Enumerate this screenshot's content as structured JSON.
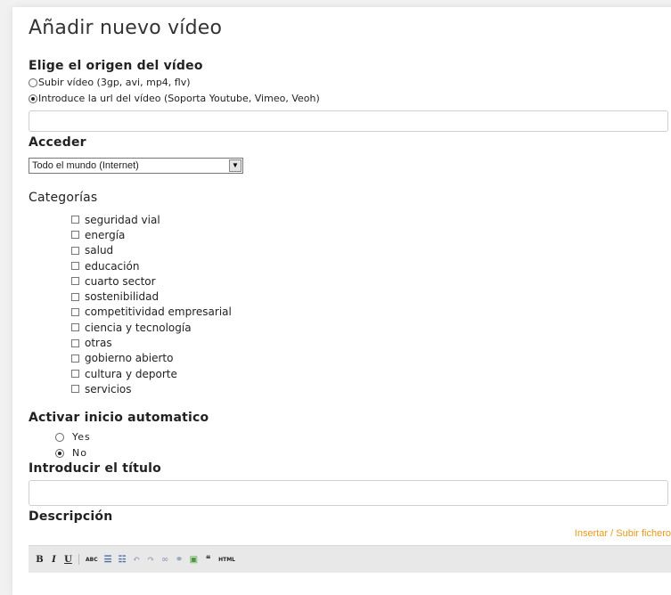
{
  "page": {
    "title": "Añadir nuevo vídeo"
  },
  "source": {
    "heading": "Elige el origen del vídeo",
    "option_upload": "Subir vídeo (3gp, avi, mp4, flv)",
    "option_url": "Introduce la url del vídeo (Soporta Youtube, Vimeo, Veoh)",
    "selected": "url",
    "url_value": ""
  },
  "access": {
    "heading": "Acceder",
    "selected": "Todo el mundo (Internet)"
  },
  "categories": {
    "heading": "Categorías",
    "items": [
      "seguridad vial",
      "energía",
      "salud",
      "educación",
      "cuarto sector",
      "sostenibilidad",
      "competitividad empresarial",
      "ciencia y tecnología",
      "otras",
      "gobierno abierto",
      "cultura y deporte",
      "servicios"
    ]
  },
  "autoplay": {
    "heading": "Activar inicio automatico",
    "yes": "Yes",
    "no": "No",
    "selected": "No"
  },
  "title_field": {
    "heading": "Introducir el título",
    "value": ""
  },
  "description": {
    "heading": "Descripción",
    "upload_link": "Insertar / Subir fichero"
  },
  "toolbar": {
    "bold": "B",
    "italic": "I",
    "underline": "U",
    "spellcheck": "ABC",
    "bullets": "☰",
    "numbers": "☷",
    "undo": "↶",
    "redo": "↷",
    "link": "∞",
    "unlink": "⚭",
    "image": "▣",
    "quote": "❝",
    "html": "HTML"
  }
}
